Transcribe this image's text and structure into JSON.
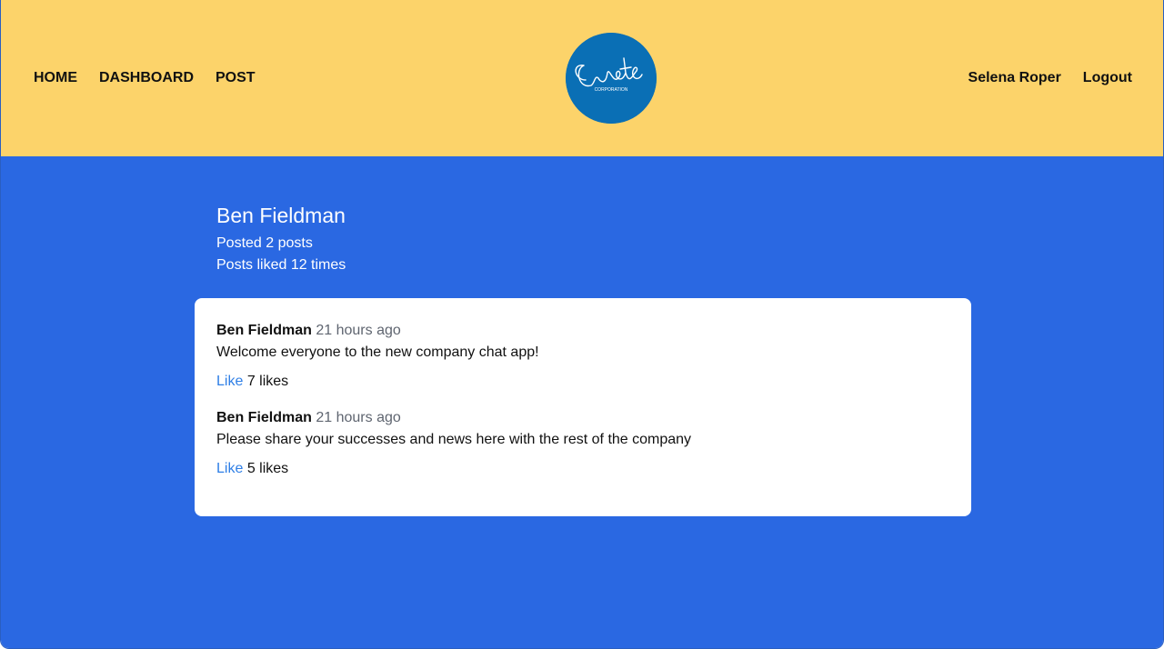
{
  "header": {
    "nav_left": [
      "HOME",
      "DASHBOARD",
      "POST"
    ],
    "logo": {
      "text": "Create",
      "subtext": "CORPORATION",
      "color": "#0a6fb5"
    },
    "user_name": "Selena Roper",
    "logout_label": "Logout",
    "background": "#fcd36a"
  },
  "profile": {
    "name": "Ben Fieldman",
    "posts_stat": "Posted 2 posts",
    "likes_stat": "Posts liked 12 times"
  },
  "posts": [
    {
      "author": "Ben Fieldman",
      "time": "21 hours ago",
      "body": "Welcome everyone to the new company chat app!",
      "like_label": "Like",
      "likes_text": "7 likes"
    },
    {
      "author": "Ben Fieldman",
      "time": "21 hours ago",
      "body": "Please share your successes and news here with the rest of the company",
      "like_label": "Like",
      "likes_text": "5 likes"
    }
  ],
  "colors": {
    "main_background": "#2a68e2",
    "link": "#2f7fe6"
  }
}
